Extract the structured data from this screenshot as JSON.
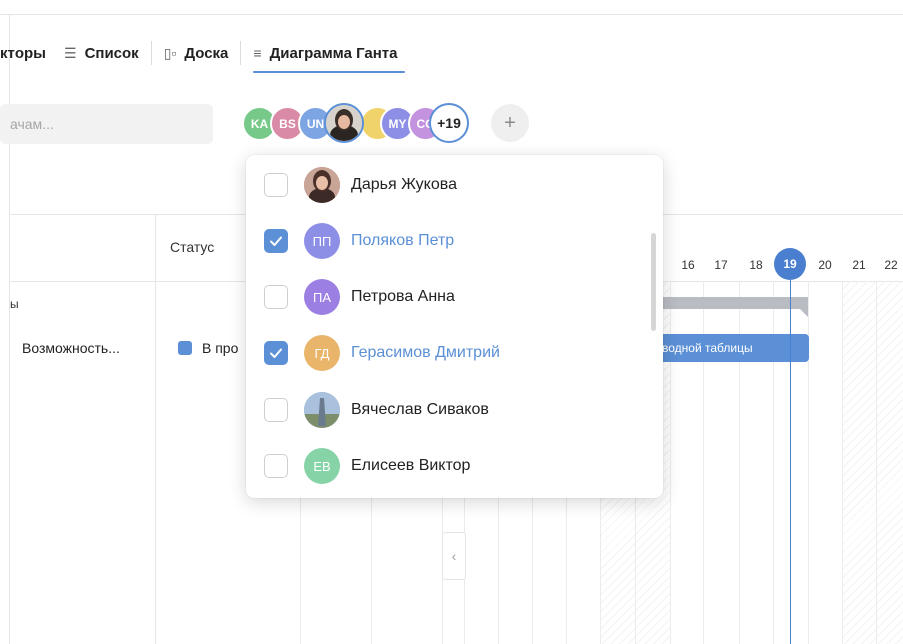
{
  "tabs": [
    {
      "label": "ктoры",
      "icon": "none"
    },
    {
      "label": "Список",
      "icon": "list-icon"
    },
    {
      "label": "Доска",
      "icon": "board-icon"
    },
    {
      "label": "Диаграмма Ганта",
      "icon": "gantt-icon",
      "active": true
    }
  ],
  "search": {
    "placeholder": "ачам..."
  },
  "avatars": {
    "items": [
      {
        "initials": "KA",
        "color": "#77c98a"
      },
      {
        "initials": "BS",
        "color": "#d98aa6"
      },
      {
        "initials": "UN",
        "color": "#7da4e3"
      },
      {
        "initials": "",
        "color": "#6b5a4f",
        "photo": true
      },
      {
        "initials": "",
        "color": "#f0d36a"
      },
      {
        "initials": "MY",
        "color": "#8d8ee6"
      },
      {
        "initials": "CO",
        "color": "#c393e0"
      }
    ],
    "more_label": "+19",
    "add_label": "+"
  },
  "table": {
    "status_header": "Статус",
    "group_label": "ы",
    "task_name": "Возможность...",
    "task_status": "В про"
  },
  "gantt": {
    "days": [
      "16",
      "17",
      "18",
      "19",
      "20",
      "21",
      "22"
    ],
    "today": "19",
    "task_bar_label": "водной таблицы",
    "collapse_glyph": "‹"
  },
  "dropdown": {
    "items": [
      {
        "name": "Дарья Жукова",
        "initials": "",
        "color": "#b07e6e",
        "photo": true,
        "checked": false
      },
      {
        "name": "Поляков Петр",
        "initials": "ПП",
        "color": "#8d8ee6",
        "checked": true
      },
      {
        "name": "Петрова Анна",
        "initials": "ПА",
        "color": "#9b7fe3",
        "checked": false
      },
      {
        "name": "Герасимов Дмитрий",
        "initials": "ГД",
        "color": "#e8b56b",
        "checked": true
      },
      {
        "name": "Вячеслав Сиваков",
        "initials": "",
        "color": "#8fa8c8",
        "photo": true,
        "checked": false
      },
      {
        "name": "Елисеев Виктор",
        "initials": "ЕВ",
        "color": "#86d3a8",
        "checked": false
      }
    ]
  },
  "colors": {
    "accent": "#5b8fd6",
    "today": "#4a7fd0"
  }
}
